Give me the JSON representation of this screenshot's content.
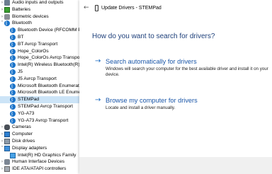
{
  "device_tree": {
    "rows": [
      {
        "label": "Audio inputs and outputs",
        "icon": "audio-icon",
        "indent": 0,
        "expander": "›"
      },
      {
        "label": "Batteries",
        "icon": "battery-icon",
        "indent": 0,
        "expander": "›"
      },
      {
        "label": "Biometric devices",
        "icon": "biometric-icon",
        "indent": 0,
        "expander": "›"
      },
      {
        "label": "Bluetooth",
        "icon": "bluetooth-icon",
        "indent": 0,
        "expander": "˅"
      },
      {
        "label": "Bluetooth Device (RFCOMM P",
        "icon": "bluetooth-icon",
        "indent": 1,
        "expander": ""
      },
      {
        "label": "BT",
        "icon": "bluetooth-icon",
        "indent": 1,
        "expander": ""
      },
      {
        "label": "BT Avrcp Transport",
        "icon": "bluetooth-icon",
        "indent": 1,
        "expander": ""
      },
      {
        "label": "Hope_ColorOs",
        "icon": "bluetooth-icon",
        "indent": 1,
        "expander": ""
      },
      {
        "label": "Hope_ColorOs Avrcp Transpor",
        "icon": "bluetooth-icon",
        "indent": 1,
        "expander": ""
      },
      {
        "label": "Intel(R) Wireless Bluetooth(R)",
        "icon": "bluetooth-icon",
        "indent": 1,
        "expander": ""
      },
      {
        "label": "J5",
        "icon": "bluetooth-icon",
        "indent": 1,
        "expander": ""
      },
      {
        "label": "J5 Avrcp Transport",
        "icon": "bluetooth-icon",
        "indent": 1,
        "expander": ""
      },
      {
        "label": "Microsoft Bluetooth Enumerat",
        "icon": "bluetooth-icon",
        "indent": 1,
        "expander": ""
      },
      {
        "label": "Microsoft Bluetooth LE Enume",
        "icon": "bluetooth-icon",
        "indent": 1,
        "expander": ""
      },
      {
        "label": "STEMPad",
        "icon": "bluetooth-icon",
        "indent": 1,
        "expander": "",
        "selected": true
      },
      {
        "label": "STEMPad Avrcp Transport",
        "icon": "bluetooth-icon",
        "indent": 1,
        "expander": ""
      },
      {
        "label": "YG-A73",
        "icon": "bluetooth-icon",
        "indent": 1,
        "expander": ""
      },
      {
        "label": "YG-A73 Avrcp Transport",
        "icon": "bluetooth-icon",
        "indent": 1,
        "expander": ""
      },
      {
        "label": "Cameras",
        "icon": "camera-icon",
        "indent": 0,
        "expander": "›"
      },
      {
        "label": "Computer",
        "icon": "computer-icon",
        "indent": 0,
        "expander": "›"
      },
      {
        "label": "Disk drives",
        "icon": "disk-drive-icon",
        "indent": 0,
        "expander": "›"
      },
      {
        "label": "Display adapters",
        "icon": "display-adapter-icon",
        "indent": 0,
        "expander": "˅"
      },
      {
        "label": "Intel(R) HD Graphics Family",
        "icon": "graphics-card-icon",
        "indent": 1,
        "expander": ""
      },
      {
        "label": "Human Interface Devices",
        "icon": "hid-icon",
        "indent": 0,
        "expander": "›"
      },
      {
        "label": "IDE ATA/ATAPI controllers",
        "icon": "ide-controller-icon",
        "indent": 0,
        "expander": "›"
      }
    ]
  },
  "dialog": {
    "back_glyph": "←",
    "title": "Update Drivers - STEMPad",
    "heading": "How do you want to search for drivers?",
    "options": [
      {
        "arrow": "→",
        "title": "Search automatically for drivers",
        "description": "Windows will search your computer for the best available driver and install it on your device."
      },
      {
        "arrow": "→",
        "title": "Browse my computer for drivers",
        "description": "Locate and install a driver manually."
      }
    ]
  },
  "colors": {
    "accent": "#1a56a8",
    "heading": "#1d3f7a",
    "selection": "#cce4f7",
    "footer": "#f0f0f0"
  }
}
